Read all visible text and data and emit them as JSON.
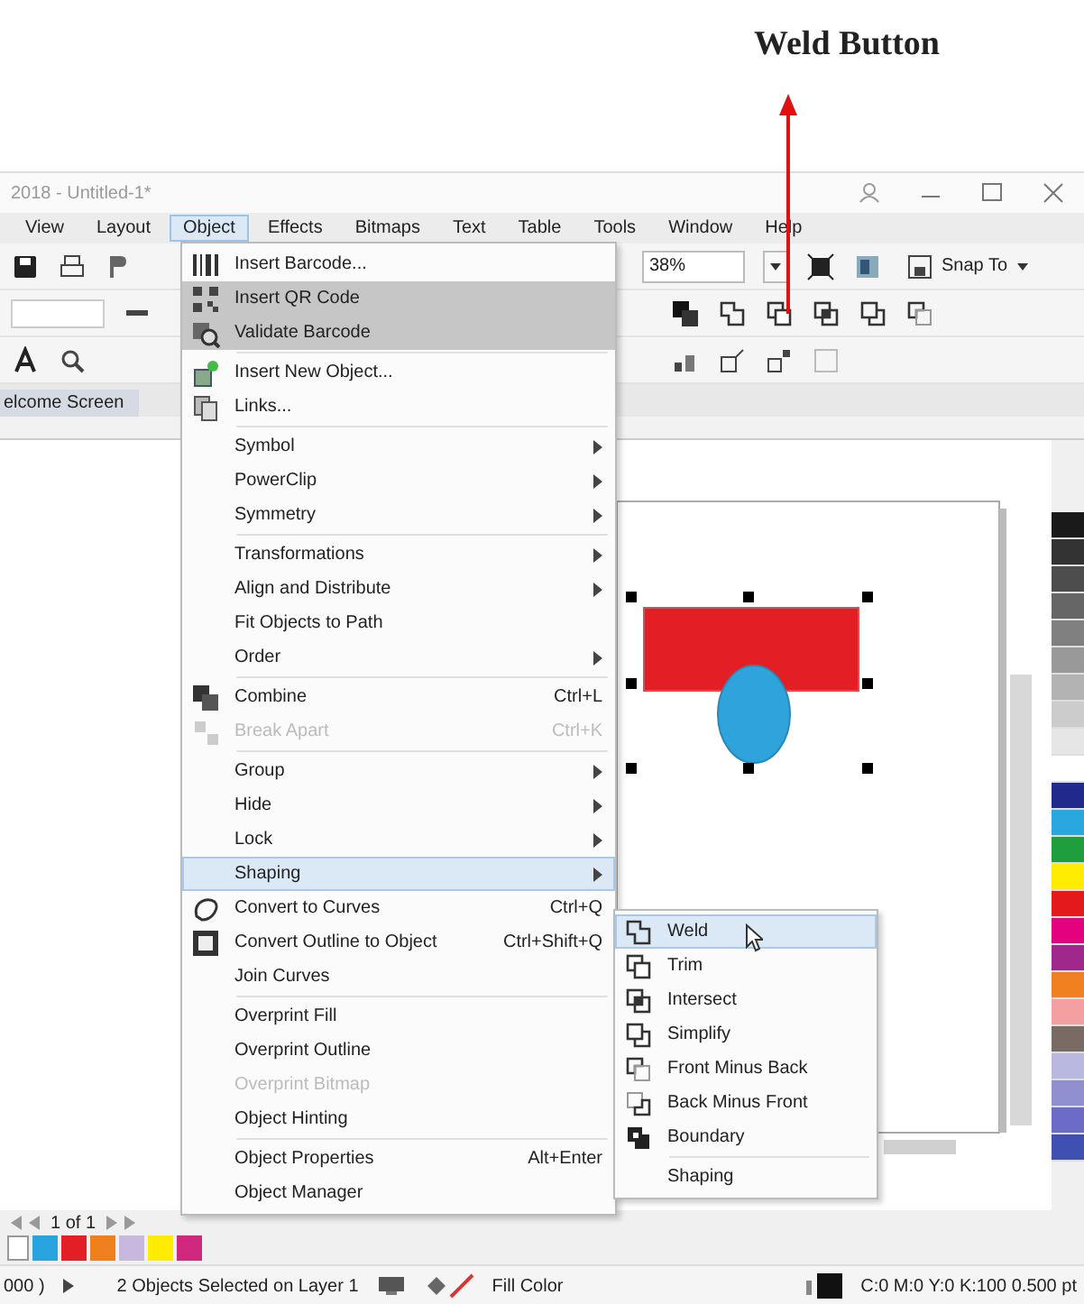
{
  "annotation": {
    "label": "Weld Button"
  },
  "window": {
    "title": "2018 - Untitled-1*"
  },
  "menu_bar": [
    {
      "label": "View",
      "selected": false
    },
    {
      "label": "Layout",
      "selected": false
    },
    {
      "label": "Object",
      "selected": true
    },
    {
      "label": "Effects",
      "selected": false
    },
    {
      "label": "Bitmaps",
      "selected": false
    },
    {
      "label": "Text",
      "selected": false
    },
    {
      "label": "Table",
      "selected": false
    },
    {
      "label": "Tools",
      "selected": false
    },
    {
      "label": "Window",
      "selected": false
    },
    {
      "label": "Help",
      "selected": false
    }
  ],
  "toolbar": {
    "zoom": "38%",
    "snap": "Snap To"
  },
  "doc_tab": {
    "label": "elcome Screen"
  },
  "object_menu": [
    {
      "kind": "item",
      "label": "Insert Barcode...",
      "submenu": false,
      "selected": false,
      "shaded": false,
      "disabled": false
    },
    {
      "kind": "item",
      "label": "Insert QR Code",
      "submenu": false,
      "selected": false,
      "shaded": true,
      "disabled": false
    },
    {
      "kind": "item",
      "label": "Validate Barcode",
      "submenu": false,
      "selected": false,
      "shaded": true,
      "disabled": false
    },
    {
      "kind": "separator"
    },
    {
      "kind": "item",
      "label": "Insert New Object...",
      "submenu": false,
      "selected": false,
      "shaded": false,
      "disabled": false
    },
    {
      "kind": "item",
      "label": "Links...",
      "submenu": false,
      "selected": false,
      "shaded": false,
      "disabled": false
    },
    {
      "kind": "separator"
    },
    {
      "kind": "item",
      "label": "Symbol",
      "submenu": true,
      "selected": false,
      "shaded": false,
      "disabled": false
    },
    {
      "kind": "item",
      "label": "PowerClip",
      "submenu": true,
      "selected": false,
      "shaded": false,
      "disabled": false
    },
    {
      "kind": "item",
      "label": "Symmetry",
      "submenu": true,
      "selected": false,
      "shaded": false,
      "disabled": false
    },
    {
      "kind": "separator"
    },
    {
      "kind": "item",
      "label": "Transformations",
      "submenu": true,
      "selected": false,
      "shaded": false,
      "disabled": false
    },
    {
      "kind": "item",
      "label": "Align and Distribute",
      "submenu": true,
      "selected": false,
      "shaded": false,
      "disabled": false
    },
    {
      "kind": "item",
      "label": "Fit Objects to Path",
      "submenu": false,
      "selected": false,
      "shaded": false,
      "disabled": false
    },
    {
      "kind": "item",
      "label": "Order",
      "submenu": true,
      "selected": false,
      "shaded": false,
      "disabled": false
    },
    {
      "kind": "separator"
    },
    {
      "kind": "item",
      "label": "Combine",
      "shortcut": "Ctrl+L",
      "submenu": false,
      "selected": false,
      "shaded": false,
      "disabled": false
    },
    {
      "kind": "item",
      "label": "Break Apart",
      "shortcut": "Ctrl+K",
      "submenu": false,
      "selected": false,
      "shaded": false,
      "disabled": true
    },
    {
      "kind": "separator"
    },
    {
      "kind": "item",
      "label": "Group",
      "submenu": true,
      "selected": false,
      "shaded": false,
      "disabled": false
    },
    {
      "kind": "item",
      "label": "Hide",
      "submenu": true,
      "selected": false,
      "shaded": false,
      "disabled": false
    },
    {
      "kind": "item",
      "label": "Lock",
      "submenu": true,
      "selected": false,
      "shaded": false,
      "disabled": false
    },
    {
      "kind": "item",
      "label": "Shaping",
      "submenu": true,
      "selected": true,
      "shaded": false,
      "disabled": false
    },
    {
      "kind": "item",
      "label": "Convert to Curves",
      "shortcut": "Ctrl+Q",
      "submenu": false,
      "selected": false,
      "shaded": false,
      "disabled": false
    },
    {
      "kind": "item",
      "label": "Convert Outline to Object",
      "shortcut": "Ctrl+Shift+Q",
      "submenu": false,
      "selected": false,
      "shaded": false,
      "disabled": false
    },
    {
      "kind": "item",
      "label": "Join Curves",
      "submenu": false,
      "selected": false,
      "shaded": false,
      "disabled": false
    },
    {
      "kind": "separator"
    },
    {
      "kind": "item",
      "label": "Overprint Fill",
      "submenu": false,
      "selected": false,
      "shaded": false,
      "disabled": false
    },
    {
      "kind": "item",
      "label": "Overprint Outline",
      "submenu": false,
      "selected": false,
      "shaded": false,
      "disabled": false
    },
    {
      "kind": "item",
      "label": "Overprint Bitmap",
      "submenu": false,
      "selected": false,
      "shaded": false,
      "disabled": true
    },
    {
      "kind": "item",
      "label": "Object Hinting",
      "submenu": false,
      "selected": false,
      "shaded": false,
      "disabled": false
    },
    {
      "kind": "separator"
    },
    {
      "kind": "item",
      "label": "Object Properties",
      "shortcut": "Alt+Enter",
      "submenu": false,
      "selected": false,
      "shaded": false,
      "disabled": false
    },
    {
      "kind": "item",
      "label": "Object Manager",
      "submenu": false,
      "selected": false,
      "shaded": false,
      "disabled": false
    }
  ],
  "shaping_submenu": [
    {
      "kind": "item",
      "label": "Weld",
      "selected": true
    },
    {
      "kind": "item",
      "label": "Trim",
      "selected": false
    },
    {
      "kind": "item",
      "label": "Intersect",
      "selected": false
    },
    {
      "kind": "item",
      "label": "Simplify",
      "selected": false
    },
    {
      "kind": "item",
      "label": "Front Minus Back",
      "selected": false
    },
    {
      "kind": "item",
      "label": "Back Minus Front",
      "selected": false
    },
    {
      "kind": "item",
      "label": "Boundary",
      "selected": false
    },
    {
      "kind": "separator"
    },
    {
      "kind": "item",
      "label": "Shaping",
      "selected": false
    }
  ],
  "palette": [
    {
      "color": "#1a1a1a"
    },
    {
      "color": "#333333"
    },
    {
      "color": "#4d4d4d"
    },
    {
      "color": "#666666"
    },
    {
      "color": "#808080"
    },
    {
      "color": "#999999"
    },
    {
      "color": "#b3b3b3"
    },
    {
      "color": "#cccccc"
    },
    {
      "color": "#e6e6e6"
    },
    {
      "color": "#ffffff"
    },
    {
      "color": "#1f2a8c"
    },
    {
      "color": "#29a8e0"
    },
    {
      "color": "#1e9e3c"
    },
    {
      "color": "#ffec00"
    },
    {
      "color": "#e3191c"
    },
    {
      "color": "#e4007f"
    },
    {
      "color": "#a0288c"
    },
    {
      "color": "#f08020"
    },
    {
      "color": "#f4a0a0"
    },
    {
      "color": "#7a6a66"
    },
    {
      "color": "#b8b8e0"
    },
    {
      "color": "#9090d0"
    },
    {
      "color": "#6c6cc8"
    },
    {
      "color": "#4050b0"
    }
  ],
  "swatches": [
    {
      "color": "#2aa4de"
    },
    {
      "color": "#e31e24"
    },
    {
      "color": "#f07f1e"
    },
    {
      "color": "#c8b8e0"
    },
    {
      "color": "#ffec00"
    },
    {
      "color": "#d0287c"
    }
  ],
  "page_nav": {
    "label": "1 of 1"
  },
  "status_bar": {
    "coords": "000 )",
    "selection": "2 Objects Selected on Layer 1",
    "fill": "Fill Color",
    "outline": "C:0 M:0 Y:0 K:100  0.500 pt"
  }
}
